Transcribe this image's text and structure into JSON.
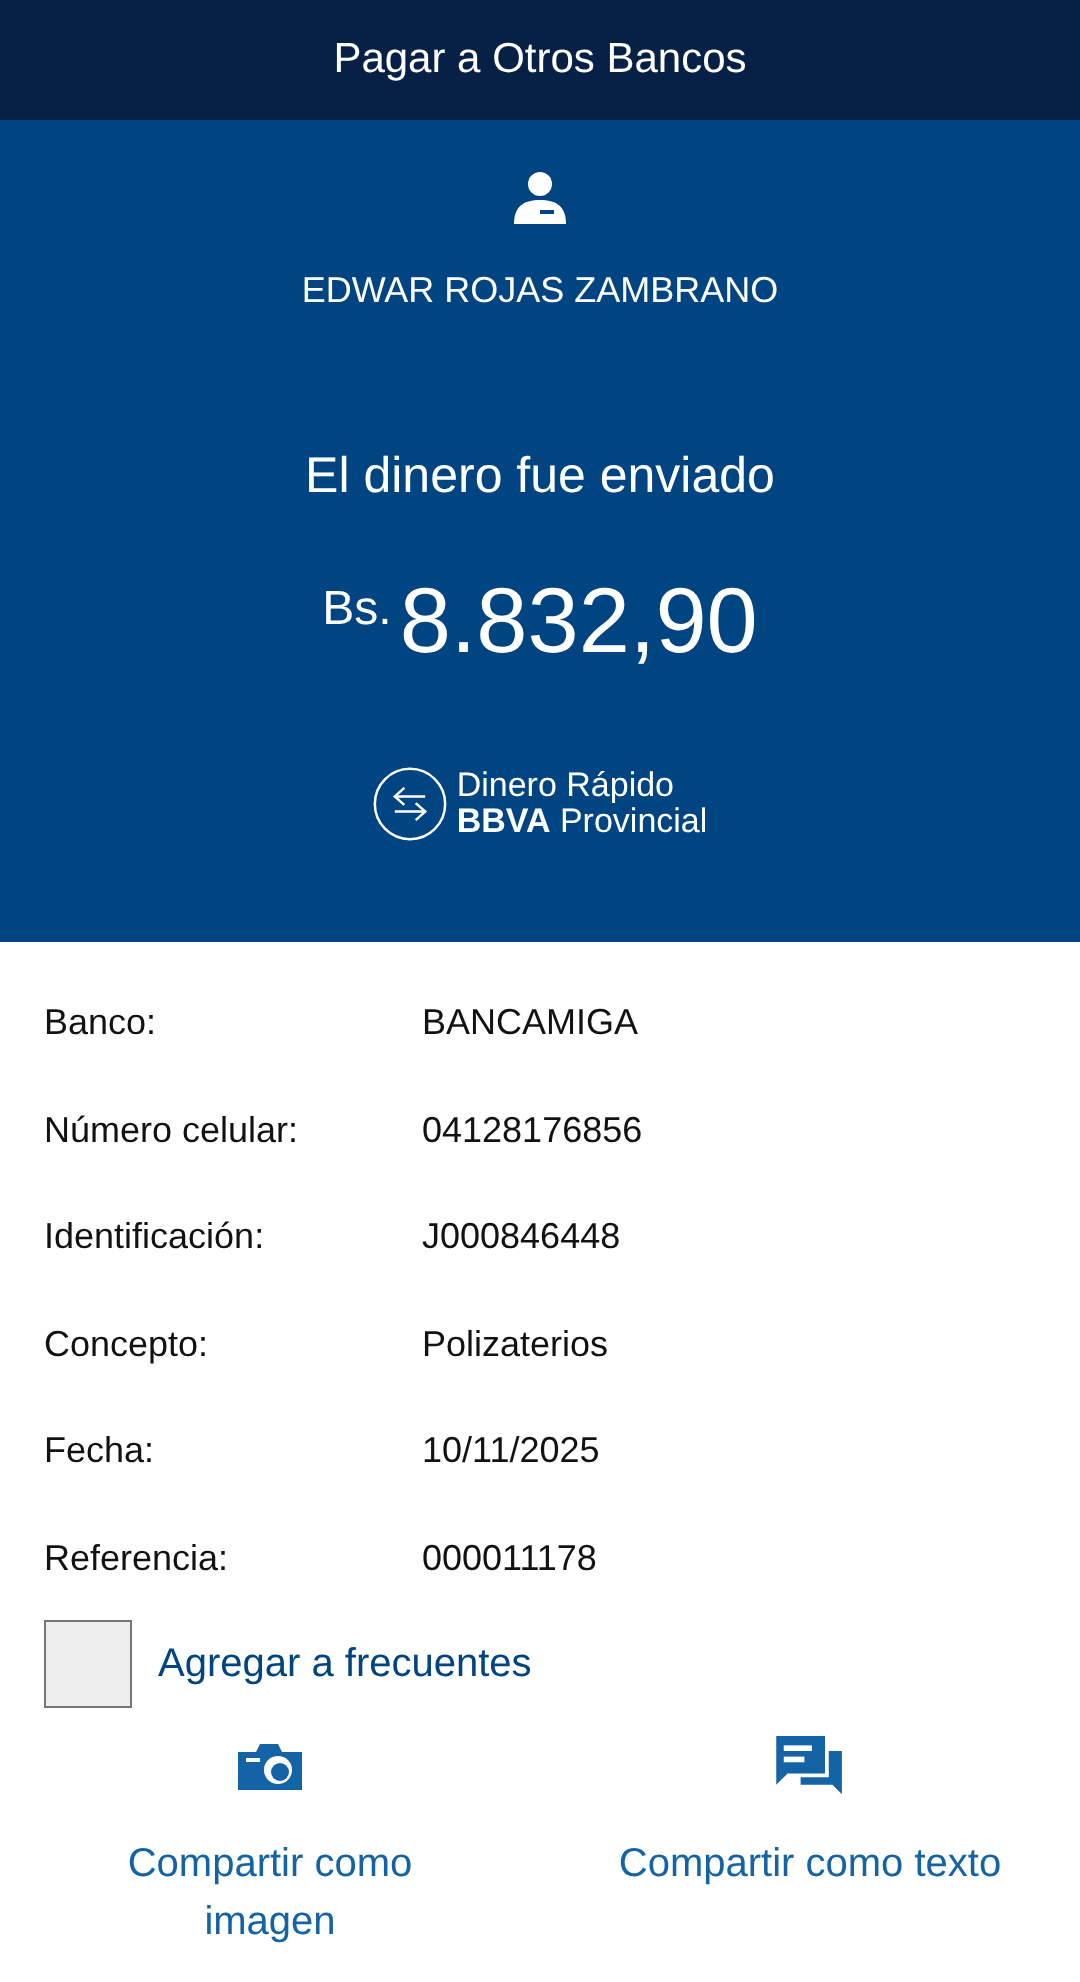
{
  "header": {
    "title": "Pagar a Otros Bancos"
  },
  "summary": {
    "recipient": "EDWAR ROJAS ZAMBRANO",
    "message": "El dinero fue enviado",
    "currency": "Bs.",
    "amount": "8.832,90",
    "logo_line_1": "Dinero Rápido",
    "logo_line_2": "**BBVA** Provincial"
  },
  "details": [
    {
      "label": "Banco:",
      "value": "BANCAMIGA"
    },
    {
      "label": "Número celular:",
      "value": "04128176856"
    },
    {
      "label": "Identificación:",
      "value": "J000846448"
    },
    {
      "label": "Concepto:",
      "value": "Polizaterios"
    },
    {
      "label": "Fecha:",
      "value": "10/11/2025"
    },
    {
      "label": "Referencia:",
      "value": "000011178"
    }
  ],
  "favorite": {
    "label": "Agregar a frecuentes",
    "checked": false
  },
  "share": [
    {
      "kind": "image",
      "label": "Compartir como imagen"
    },
    {
      "kind": "text",
      "label": "Compartir como texto"
    }
  ]
}
